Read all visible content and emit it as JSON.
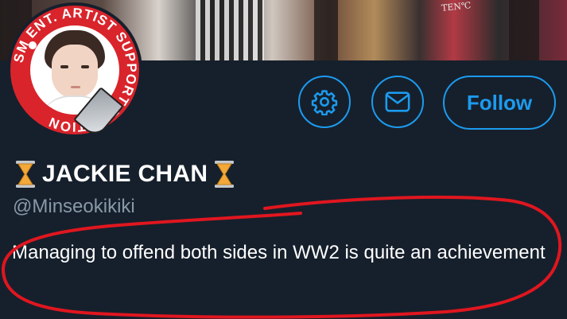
{
  "profile": {
    "avatar_ring_text": "SM ENT. ARTIST SUPPORT PETITION",
    "display_name": "JACKIE CHAN",
    "name_prefix_emoji": "⌛",
    "name_suffix_emoji": "⌛",
    "handle": "@Minseokikiki",
    "bio": "Managing to offend both sides in WW2 is quite an achievement"
  },
  "banner": {
    "visible_text": "TEN℃"
  },
  "actions": {
    "settings_icon": "gear-icon",
    "message_icon": "envelope-icon",
    "follow_label": "Follow"
  },
  "colors": {
    "background": "#16202c",
    "accent": "#1c9bef",
    "secondary_text": "#8899a6",
    "annotation": "#e0161f",
    "avatar_ring": "#d9242b"
  }
}
